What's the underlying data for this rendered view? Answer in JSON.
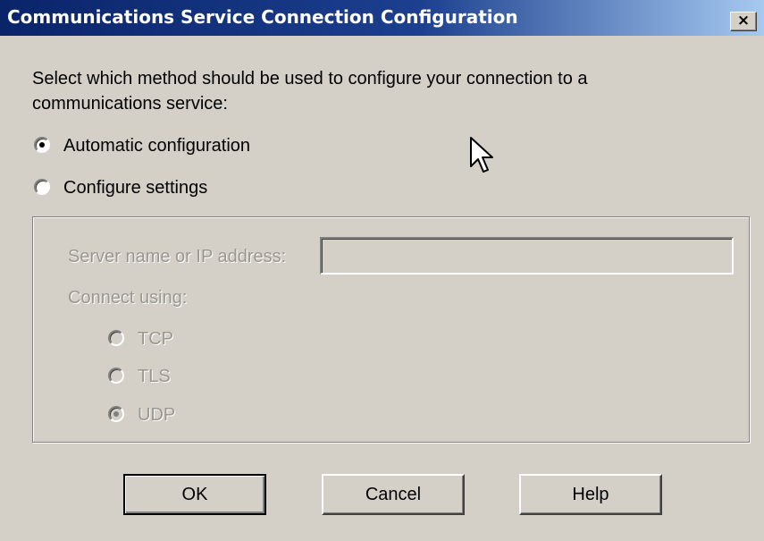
{
  "window": {
    "title": "Communications Service Connection Configuration",
    "close_glyph": "×"
  },
  "prompt": "Select which method should be used to configure your connection to a communications service:",
  "method_options": [
    {
      "label": "Automatic configuration",
      "selected": true
    },
    {
      "label": "Configure settings",
      "selected": false
    }
  ],
  "settings": {
    "server_label": "Server name or IP address:",
    "server_value": "",
    "connect_label": "Connect using:",
    "protocols": [
      {
        "label": "TCP",
        "selected": false
      },
      {
        "label": "TLS",
        "selected": false
      },
      {
        "label": "UDP",
        "selected": true
      }
    ],
    "enabled": false
  },
  "buttons": {
    "ok": "OK",
    "cancel": "Cancel",
    "help": "Help"
  },
  "colors": {
    "titlebar_start": "#0a246a",
    "titlebar_end": "#a6caf0",
    "dialog_bg": "#d4d0c8",
    "disabled_text": "#9a978f"
  },
  "icons": {
    "close": "close-icon",
    "cursor": "mouse-pointer-icon"
  }
}
